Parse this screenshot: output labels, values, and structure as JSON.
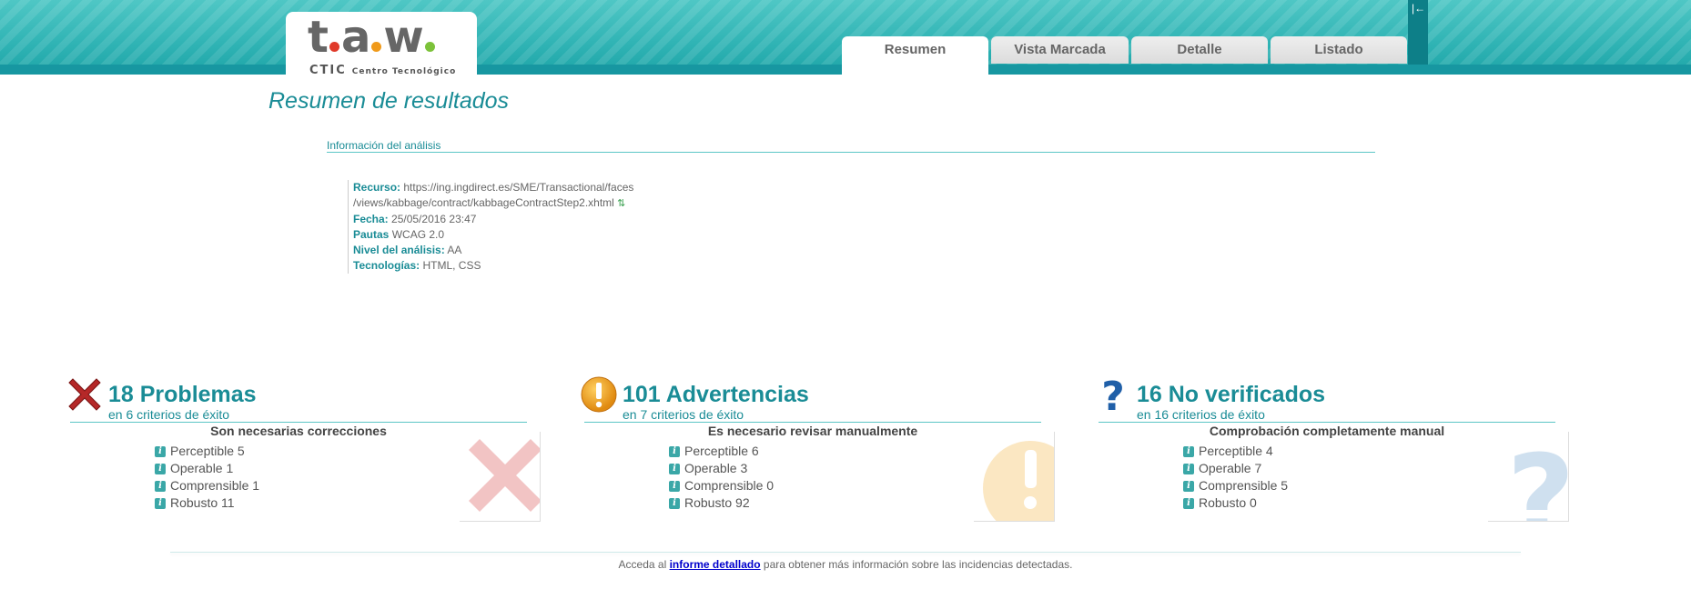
{
  "header": {
    "logo": {
      "main": "t.a.w.",
      "sub": "CTIC",
      "sub2": "Centro Tecnológico"
    },
    "tabs": [
      {
        "label": "Resumen",
        "active": true
      },
      {
        "label": "Vista Marcada",
        "active": false
      },
      {
        "label": "Detalle",
        "active": false
      },
      {
        "label": "Listado",
        "active": false
      }
    ],
    "collapse_glyph": "|←"
  },
  "page": {
    "title": "Resumen de resultados",
    "info_title": "Información del análisis"
  },
  "info": {
    "resource_label": "Recurso:",
    "resource_value_line1": "https://ing.ingdirect.es/SME/Transactional/faces",
    "resource_value_line2": "/views/kabbage/contract/kabbageContractStep2.xhtml",
    "date_label": "Fecha:",
    "date_value": "25/05/2016 23:47",
    "guidelines_label": "Pautas",
    "guidelines_value": "WCAG 2.0",
    "level_label": "Nivel del análisis:",
    "level_value": "AA",
    "tech_label": "Tecnologías:",
    "tech_value": "HTML, CSS"
  },
  "columns": {
    "problems": {
      "count": "18 Problemas",
      "sub": "en 6 criterios de éxito",
      "note": "Son necesarias correcciones",
      "items": [
        "Perceptible 5",
        "Operable 1",
        "Comprensible 1",
        "Robusto 11"
      ],
      "color": "#b02a2a"
    },
    "warnings": {
      "count": "101 Advertencias",
      "sub": "en 7 criterios de éxito",
      "note": "Es necesario revisar manualmente",
      "items": [
        "Perceptible 6",
        "Operable 3",
        "Comprensible 0",
        "Robusto 92"
      ],
      "color": "#f0a020"
    },
    "unverified": {
      "count": "16 No verificados",
      "sub": "en 16 criterios de éxito",
      "note": "Comprobación completamente manual",
      "items": [
        "Perceptible 4",
        "Operable 7",
        "Comprensible 5",
        "Robusto 0"
      ],
      "color": "#1f5fa8"
    }
  },
  "footer": {
    "prefix": "Acceda al ",
    "link": "informe detallado",
    "suffix": " para obtener más información sobre las incidencias detectadas."
  }
}
